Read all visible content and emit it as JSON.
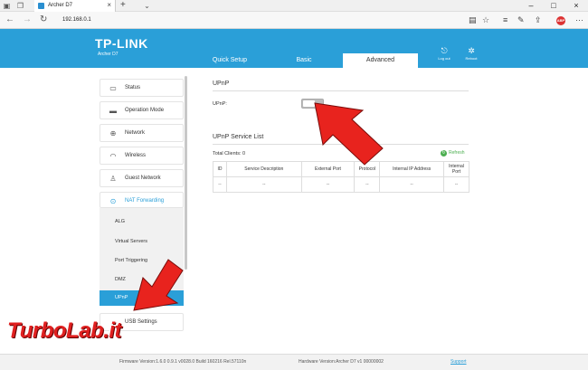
{
  "browser": {
    "tab_title": "Archer D7",
    "url": "192.168.0.1",
    "icons": [
      "back-icon",
      "forward-icon",
      "refresh-icon",
      "reading-view-icon",
      "favorite-star-icon",
      "hub-icon",
      "notes-icon",
      "share-icon",
      "adblock-icon",
      "more-icon"
    ],
    "adblock_label": "ABP"
  },
  "header": {
    "brand": "TP-LINK",
    "model": "Archer D7",
    "tabs": [
      {
        "label": "Quick Setup",
        "active": false
      },
      {
        "label": "Basic",
        "active": false
      },
      {
        "label": "Advanced",
        "active": true
      }
    ],
    "logout_label": "Log out",
    "reboot_label": "Reboot"
  },
  "sidebar": {
    "items": [
      {
        "label": "Status",
        "icon": "status-icon"
      },
      {
        "label": "Operation Mode",
        "icon": "monitor-icon"
      },
      {
        "label": "Network",
        "icon": "globe-icon"
      },
      {
        "label": "Wireless",
        "icon": "wifi-icon"
      },
      {
        "label": "Guest Network",
        "icon": "guest-icon"
      },
      {
        "label": "NAT Forwarding",
        "icon": "nat-icon",
        "open": true
      },
      {
        "label": "USB Settings",
        "icon": "usb-icon"
      }
    ],
    "subitems": [
      {
        "label": "ALG"
      },
      {
        "label": "Virtual Servers"
      },
      {
        "label": "Port Triggering"
      },
      {
        "label": "DMZ"
      },
      {
        "label": "UPnP",
        "active": true
      }
    ]
  },
  "main": {
    "upnp_title": "UPnP",
    "upnp_label": "UPnP:",
    "upnp_enabled": false,
    "service_list_title": "UPnP Service List",
    "total_clients_label": "Total Clients: 0",
    "refresh_label": "Refresh",
    "table": {
      "headers": [
        "ID",
        "Service Description",
        "External Port",
        "Protocol",
        "Internal IP Address",
        "Internal Port"
      ],
      "rows": [
        [
          "--",
          "--",
          "--",
          "--",
          "--",
          "--"
        ]
      ]
    }
  },
  "footer": {
    "firmware": "Firmware Version:1.6.0 0.9.1 v0028.0 Build 160216 Rel.57110n",
    "hardware": "Hardware Version:Archer D7 v1 00000002",
    "support": "Support"
  },
  "watermark": "TurboLab.it",
  "colors": {
    "accent": "#2a9fd8",
    "arrow": "#e8231e",
    "refresh": "#4caf50"
  }
}
